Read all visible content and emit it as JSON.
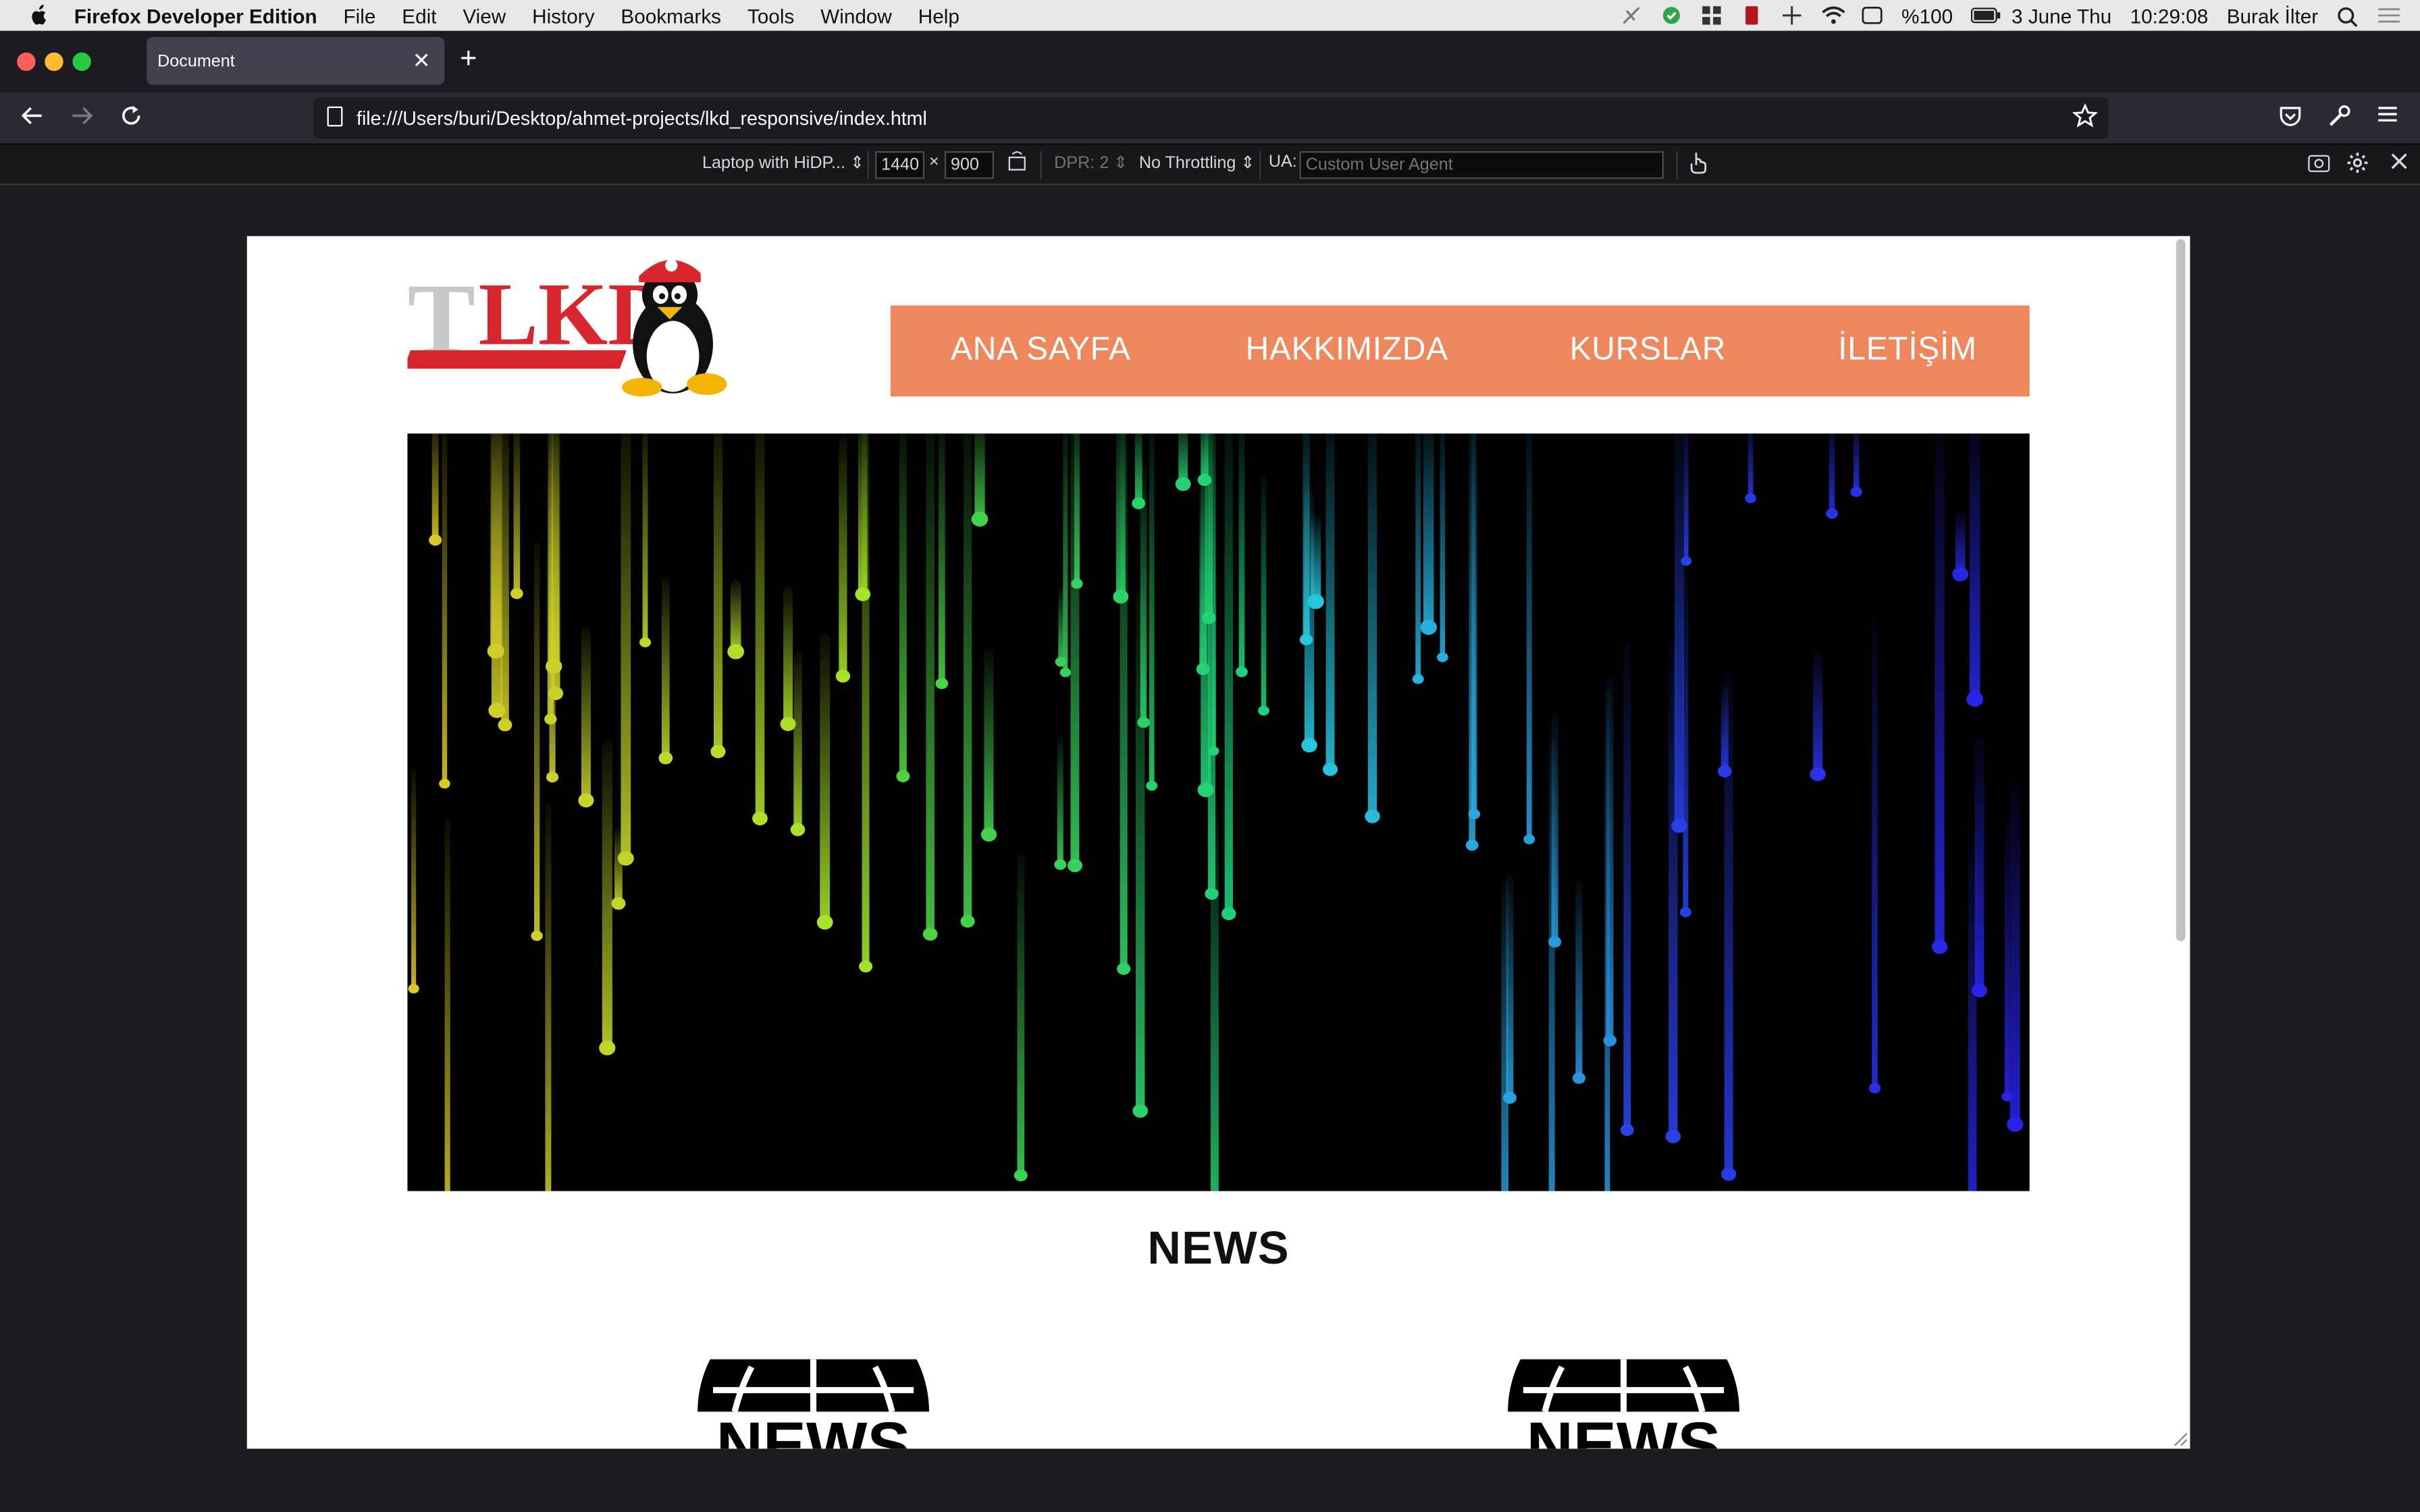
{
  "menubar": {
    "app_name": "Firefox Developer Edition",
    "menus": [
      "File",
      "Edit",
      "View",
      "History",
      "Bookmarks",
      "Tools",
      "Window",
      "Help"
    ],
    "battery": "%100",
    "date": "3 June Thu",
    "time": "10:29:08",
    "user": "Burak İlter"
  },
  "tabs": [
    {
      "title": "Document"
    }
  ],
  "urlbar": {
    "url": "file:///Users/buri/Desktop/ahmet-projects/lkd_responsive/index.html"
  },
  "rdm": {
    "device": "Laptop with HiDP...",
    "width": "1440",
    "times": "×",
    "height": "900",
    "dpr": "DPR: 2",
    "throttling": "No Throttling",
    "ua_label": "UA:",
    "ua_placeholder": "Custom User Agent"
  },
  "page": {
    "logo_text": "LKD",
    "nav": [
      "ANA SAYFA",
      "HAKKIMIZDA",
      "KURSLAR",
      "İLETİŞİM"
    ],
    "news_heading": "NEWS",
    "news_icon_text": "NEWS"
  },
  "colors": {
    "nav_bg": "#ee875b",
    "logo_red": "#d8262e",
    "hero_bg": "#000000"
  }
}
